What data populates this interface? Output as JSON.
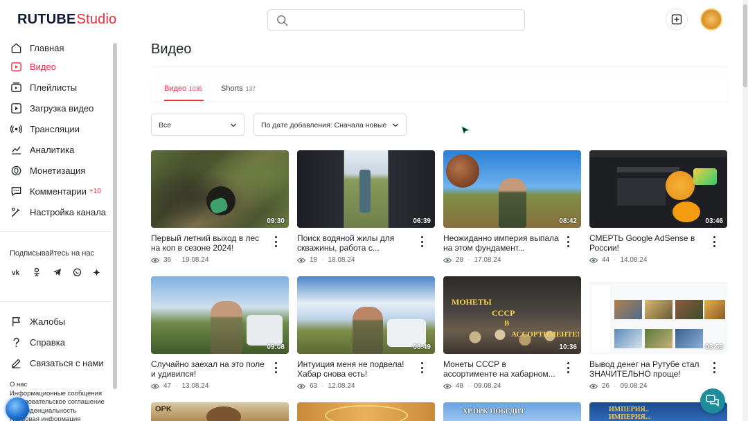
{
  "header": {
    "logo_main": "RUTUBE",
    "logo_sub": "Studio",
    "search_placeholder": ""
  },
  "sidebar": {
    "items": [
      {
        "label": "Главная",
        "icon": "home-icon"
      },
      {
        "label": "Видео",
        "icon": "video-icon",
        "active": true
      },
      {
        "label": "Плейлисты",
        "icon": "playlist-icon"
      },
      {
        "label": "Загрузка видео",
        "icon": "upload-icon"
      },
      {
        "label": "Трансляции",
        "icon": "broadcast-icon"
      },
      {
        "label": "Аналитика",
        "icon": "analytics-icon"
      },
      {
        "label": "Монетизация",
        "icon": "monetization-icon"
      },
      {
        "label": "Комментарии",
        "icon": "comments-icon",
        "badge": "+10"
      },
      {
        "label": "Настройка канала",
        "icon": "settings-icon"
      }
    ],
    "follow_title": "Подписывайтесь на нас",
    "social": [
      "vk-icon",
      "ok-icon",
      "telegram-icon",
      "viber-icon",
      "zen-icon"
    ],
    "support_items": [
      {
        "label": "Жалобы",
        "icon": "flag-icon"
      },
      {
        "label": "Справка",
        "icon": "help-icon"
      },
      {
        "label": "Связаться с нами",
        "icon": "edit-icon"
      }
    ],
    "footer_links": [
      "О нас",
      "Информационные сообщения",
      "Пользовательское соглашение",
      "Конфиденциальность",
      "Правовая информация"
    ]
  },
  "main": {
    "title": "Видео",
    "tabs": [
      {
        "label": "Видео",
        "count": "1035",
        "active": true
      },
      {
        "label": "Shorts",
        "count": "137",
        "active": false
      }
    ],
    "filter_select": "Все",
    "sort_select": "По дате добавления: Сначала новые"
  },
  "videos": [
    {
      "title": "Первый летний выход в лес на коп в сезоне 2024!",
      "duration": "09:30",
      "views": "36",
      "date": "19.08.24"
    },
    {
      "title": "Поиск водяной жилы для скважины, работа с...",
      "duration": "06:39",
      "views": "18",
      "date": "18.08.24"
    },
    {
      "title": "Неожиданно империя выпала на этом фундамент...",
      "duration": "08:42",
      "views": "28",
      "date": "17.08.24"
    },
    {
      "title": "СМЕРТЬ Google AdSense в России!",
      "duration": "03:46",
      "views": "44",
      "date": "14.08.24"
    },
    {
      "title": "Случайно заехал на это поле и удивился!",
      "duration": "09:08",
      "views": "47",
      "date": "13.08.24"
    },
    {
      "title": "Интуиция меня не подвела! Хабар снова есть!",
      "duration": "08:49",
      "views": "63",
      "date": "12.08.24"
    },
    {
      "title": "Монеты СССР в ассортименте на хабарном...",
      "duration": "10:36",
      "views": "48",
      "date": "09.08.24"
    },
    {
      "title": "Вывод денег на Рутубе стал ЗНАЧИТЕЛЬНО проще!",
      "duration": "03:53",
      "views": "26",
      "date": "09.08.24"
    }
  ],
  "thumb_texts": {
    "v7_line1": "МОНЕТЫ",
    "v7_line2": "СССР",
    "v7_line3": "В",
    "v7_line4": "АССОРТИМЕНТЕ!",
    "row3_a": "OPK",
    "row3_c": "XP OPK ПОБЕДИТ",
    "row3_d": "ИМПЕРИЯ.. ИМПЕРИЯ..."
  },
  "colors": {
    "accent": "#ef2a3f",
    "fab": "#1e8d9a"
  }
}
